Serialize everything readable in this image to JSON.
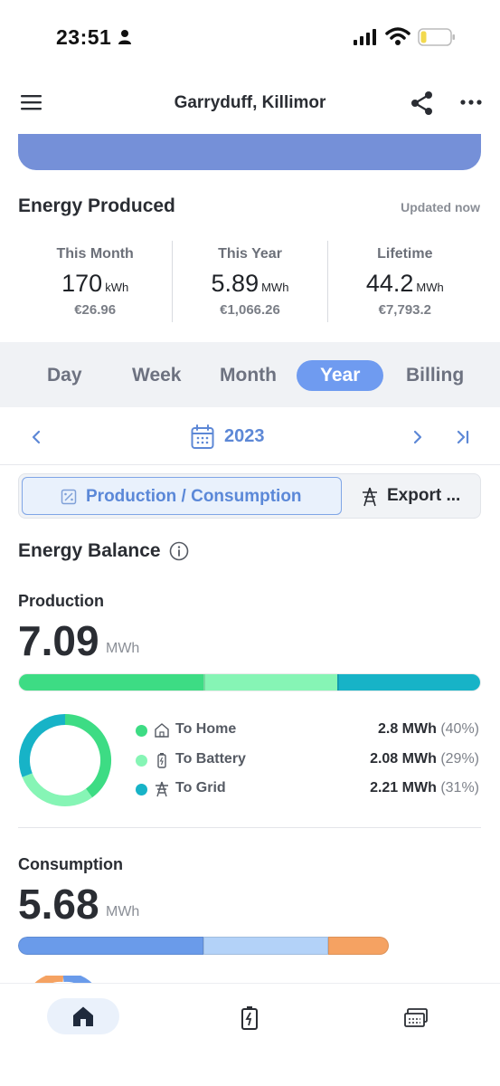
{
  "status_bar": {
    "time": "23:51"
  },
  "header": {
    "title": "Garryduff, Killimor"
  },
  "energy_produced": {
    "title": "Energy Produced",
    "updated": "Updated now",
    "stats": [
      {
        "label": "This Month",
        "value": "170",
        "unit": "kWh",
        "money": "€26.96"
      },
      {
        "label": "This Year",
        "value": "5.89",
        "unit": "MWh",
        "money": "€1,066.26"
      },
      {
        "label": "Lifetime",
        "value": "44.2",
        "unit": "MWh",
        "money": "€7,793.2"
      }
    ]
  },
  "tabs": {
    "day": "Day",
    "week": "Week",
    "month": "Month",
    "year": "Year",
    "billing": "Billing",
    "active": "Year"
  },
  "date_nav": {
    "label": "2023"
  },
  "view_toggle": {
    "production_consumption": "Production / Consumption",
    "export": "Export ..."
  },
  "energy_balance": {
    "title": "Energy Balance",
    "production": {
      "label": "Production",
      "value": "7.09",
      "unit": "MWh",
      "breakdown": [
        {
          "name": "To Home",
          "value": "2.8 MWh",
          "pct": "(40%)",
          "share": 0.4,
          "color": "#3ddc84",
          "icon": "home-icon"
        },
        {
          "name": "To Battery",
          "value": "2.08 MWh",
          "pct": "(29%)",
          "share": 0.29,
          "color": "#86f5b5",
          "icon": "battery-icon"
        },
        {
          "name": "To Grid",
          "value": "2.21 MWh",
          "pct": "(31%)",
          "share": 0.31,
          "color": "#17b3c7",
          "icon": "grid-tower-icon"
        }
      ]
    },
    "consumption": {
      "label": "Consumption",
      "value": "5.68",
      "unit": "MWh",
      "segments": [
        {
          "share": 0.4,
          "color": "#6a9bea"
        },
        {
          "share": 0.27,
          "color": "#b3d2f8"
        },
        {
          "share": 0.13,
          "color": "#f5a262"
        }
      ]
    }
  },
  "colors": {
    "accent": "#6f9bf0",
    "banner": "#7590d8"
  }
}
